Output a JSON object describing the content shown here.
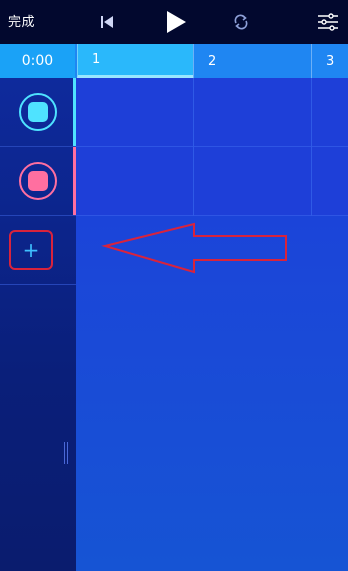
{
  "toolbar": {
    "done_label": "完成",
    "icons": [
      "skip-to-start-icon",
      "play-icon",
      "loop-icon",
      "mixer-sliders-icon"
    ]
  },
  "ruler": {
    "time": "0:00",
    "bars": [
      "1",
      "2",
      "3"
    ]
  },
  "tracks": [
    {
      "name": "cyan-track",
      "color": "#4fe3ff",
      "accent": "#4fe3ff"
    },
    {
      "name": "pink-track",
      "color": "#ff6fa0",
      "accent": "#ff6fa0"
    }
  ],
  "add_track": {
    "icon": "plus-icon",
    "label": "+"
  },
  "colors": {
    "toolbar_bg": "#02082e",
    "ruler_bg": "#1f86f2",
    "selected_bar": "#2ab8fb",
    "annotation": "#d9233c"
  }
}
